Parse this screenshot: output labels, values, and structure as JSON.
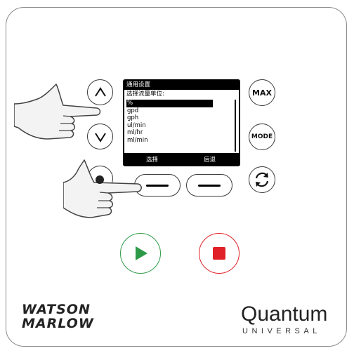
{
  "screen": {
    "title": "通用设置",
    "prompt": "选择流量单位:",
    "options": [
      "%",
      "gpd",
      "gph",
      "ul/min",
      "ml/hr",
      "ml/min"
    ],
    "selected_index": 0,
    "soft_left": "选择",
    "soft_right": "后退"
  },
  "buttons": {
    "max_label": "MAX",
    "mode_label": "MODE"
  },
  "logos": {
    "wm_line1": "WATSON",
    "wm_line2": "MARLOW",
    "q_main": "Quantum",
    "q_sub": "UNIVERSAL"
  },
  "colors": {
    "start": "#2e9a47",
    "stop": "#e02127"
  },
  "icons": {
    "up": "chevron-up-icon",
    "down": "chevron-down-icon",
    "direction": "rotate-arrows-icon",
    "start": "play-icon",
    "stop": "stop-icon"
  }
}
